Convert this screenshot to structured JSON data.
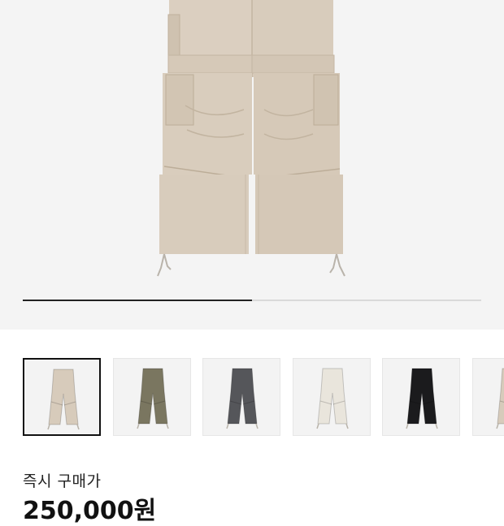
{
  "gallery": {
    "progress_fraction": 0.5,
    "thumbnails": [
      {
        "color": "#d7cbbb",
        "selected": true
      },
      {
        "color": "#7a7660",
        "selected": false
      },
      {
        "color": "#55565a",
        "selected": false
      },
      {
        "color": "#e9e5dc",
        "selected": false
      },
      {
        "color": "#1b1b1d",
        "selected": false
      },
      {
        "color": "#d7cbbb",
        "selected": false
      }
    ]
  },
  "purchase": {
    "label": "즉시 구매가",
    "price": "250,000원"
  },
  "colors": {
    "hero_bg": "#f4f4f4",
    "pants_main": "#d9cdbd",
    "pants_shadow": "#c8baa7"
  }
}
